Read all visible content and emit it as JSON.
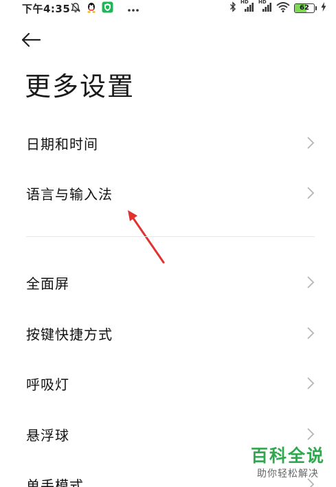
{
  "status_bar": {
    "time": "下午4:35",
    "left_icons": [
      "mute-bell-icon",
      "qq-penguin-icon",
      "shield-app-icon",
      "more-dots-icon"
    ],
    "signal_label_1": "HD",
    "signal_label_2": "HD",
    "battery_level": "62",
    "battery_fraction": 0.62,
    "right_icons": [
      "bluetooth-icon",
      "signal-hd-icon",
      "signal-hd-icon",
      "wifi-icon",
      "battery-icon",
      "charging-bolt-icon"
    ]
  },
  "header": {
    "back_icon": "back-arrow-icon",
    "title": "更多设置"
  },
  "menu": {
    "items": [
      {
        "label": "日期和时间"
      },
      {
        "label": "语言与输入法"
      },
      {
        "label": "全面屏"
      },
      {
        "label": "按键快捷方式"
      },
      {
        "label": "呼吸灯"
      },
      {
        "label": "悬浮球"
      },
      {
        "label": "单手模式"
      }
    ]
  },
  "annotation": {
    "arrow_color": "#e0322f"
  },
  "watermark": {
    "title": "百科全说",
    "subtitle": "助你轻松解决"
  },
  "colors": {
    "accent_green": "#2fa84f",
    "divider": "#e6e6e6",
    "chevron": "#b5b5b5"
  }
}
